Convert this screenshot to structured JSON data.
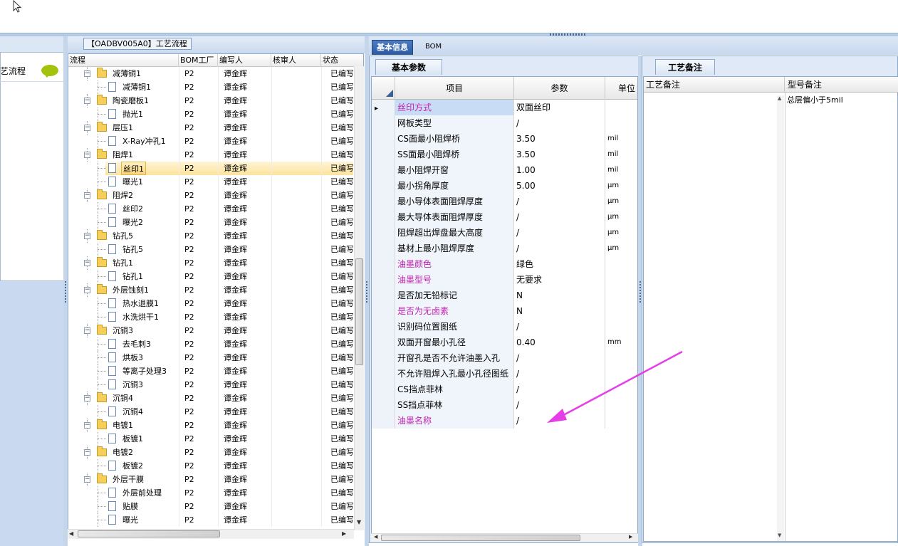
{
  "window": {
    "accent": "#2a5aa6",
    "note_color": "#c21fae"
  },
  "sidebar": {
    "label": "艺流程",
    "icon": "speech-bubble-icon"
  },
  "tree_panel": {
    "tab_title": "【OADBV005A0】工艺流程",
    "columns": [
      "流程",
      "BOM工厂",
      "编写人",
      "核审人",
      "状态"
    ],
    "rows": [
      {
        "name": "减薄铜1",
        "type": "folder",
        "bom": "P2",
        "author": "谭金辉",
        "reviewer": "",
        "status": "已编写"
      },
      {
        "name": "减薄铜1",
        "type": "item",
        "bom": "P2",
        "author": "谭金辉",
        "reviewer": "",
        "status": "已编写"
      },
      {
        "name": "陶瓷磨板1",
        "type": "folder",
        "bom": "P2",
        "author": "谭金辉",
        "reviewer": "",
        "status": "已编写"
      },
      {
        "name": "抛光1",
        "type": "item",
        "bom": "P2",
        "author": "谭金辉",
        "reviewer": "",
        "status": "已编写"
      },
      {
        "name": "层压1",
        "type": "folder",
        "bom": "P2",
        "author": "谭金辉",
        "reviewer": "",
        "status": "已编写"
      },
      {
        "name": "X-Ray冲孔1",
        "type": "item",
        "bom": "P2",
        "author": "谭金辉",
        "reviewer": "",
        "status": "已编写"
      },
      {
        "name": "阻焊1",
        "type": "folder",
        "bom": "P2",
        "author": "谭金辉",
        "reviewer": "",
        "status": "已编写"
      },
      {
        "name": "丝印1",
        "type": "item",
        "bom": "P2",
        "author": "谭金辉",
        "reviewer": "",
        "status": "已编写",
        "selected": true
      },
      {
        "name": "曝光1",
        "type": "item",
        "bom": "P2",
        "author": "谭金辉",
        "reviewer": "",
        "status": "已编写"
      },
      {
        "name": "阻焊2",
        "type": "folder",
        "bom": "P2",
        "author": "谭金辉",
        "reviewer": "",
        "status": "已编写"
      },
      {
        "name": "丝印2",
        "type": "item",
        "bom": "P2",
        "author": "谭金辉",
        "reviewer": "",
        "status": "已编写"
      },
      {
        "name": "曝光2",
        "type": "item",
        "bom": "P2",
        "author": "谭金辉",
        "reviewer": "",
        "status": "已编写"
      },
      {
        "name": "钻孔5",
        "type": "folder",
        "bom": "P2",
        "author": "谭金辉",
        "reviewer": "",
        "status": "已编写"
      },
      {
        "name": "钻孔5",
        "type": "item",
        "bom": "P2",
        "author": "谭金辉",
        "reviewer": "",
        "status": "已编写"
      },
      {
        "name": "钻孔1",
        "type": "folder",
        "bom": "P2",
        "author": "谭金辉",
        "reviewer": "",
        "status": "已编写"
      },
      {
        "name": "钻孔1",
        "type": "item",
        "bom": "P2",
        "author": "谭金辉",
        "reviewer": "",
        "status": "已编写"
      },
      {
        "name": "外层蚀刻1",
        "type": "folder",
        "bom": "P2",
        "author": "谭金辉",
        "reviewer": "",
        "status": "已编写"
      },
      {
        "name": "热水退膜1",
        "type": "item",
        "bom": "P2",
        "author": "谭金辉",
        "reviewer": "",
        "status": "已编写"
      },
      {
        "name": "水洗烘干1",
        "type": "item",
        "bom": "P2",
        "author": "谭金辉",
        "reviewer": "",
        "status": "已编写"
      },
      {
        "name": "沉铜3",
        "type": "folder",
        "bom": "P2",
        "author": "谭金辉",
        "reviewer": "",
        "status": "已编写"
      },
      {
        "name": "去毛刺3",
        "type": "item",
        "bom": "P2",
        "author": "谭金辉",
        "reviewer": "",
        "status": "已编写"
      },
      {
        "name": "烘板3",
        "type": "item",
        "bom": "P2",
        "author": "谭金辉",
        "reviewer": "",
        "status": "已编写"
      },
      {
        "name": "等离子处理3",
        "type": "item",
        "bom": "P2",
        "author": "谭金辉",
        "reviewer": "",
        "status": "已编写"
      },
      {
        "name": "沉铜3",
        "type": "item",
        "bom": "P2",
        "author": "谭金辉",
        "reviewer": "",
        "status": "已编写"
      },
      {
        "name": "沉铜4",
        "type": "folder",
        "bom": "P2",
        "author": "谭金辉",
        "reviewer": "",
        "status": "已编写"
      },
      {
        "name": "沉铜4",
        "type": "item",
        "bom": "P2",
        "author": "谭金辉",
        "reviewer": "",
        "status": "已编写"
      },
      {
        "name": "电镀1",
        "type": "folder",
        "bom": "P2",
        "author": "谭金辉",
        "reviewer": "",
        "status": "已编写"
      },
      {
        "name": "板镀1",
        "type": "item",
        "bom": "P2",
        "author": "谭金辉",
        "reviewer": "",
        "status": "已编写"
      },
      {
        "name": "电镀2",
        "type": "folder",
        "bom": "P2",
        "author": "谭金辉",
        "reviewer": "",
        "status": "已编写"
      },
      {
        "name": "板镀2",
        "type": "item",
        "bom": "P2",
        "author": "谭金辉",
        "reviewer": "",
        "status": "已编写"
      },
      {
        "name": "外层干膜",
        "type": "folder",
        "bom": "P2",
        "author": "谭金辉",
        "reviewer": "",
        "status": "已编写"
      },
      {
        "name": "外层前处理",
        "type": "item",
        "bom": "P2",
        "author": "谭金辉",
        "reviewer": "",
        "status": "已编写"
      },
      {
        "name": "贴膜",
        "type": "item",
        "bom": "P2",
        "author": "谭金辉",
        "reviewer": "",
        "status": "已编写"
      },
      {
        "name": "曝光",
        "type": "item",
        "bom": "P2",
        "author": "谭金辉",
        "reviewer": "",
        "status": "已编写"
      }
    ]
  },
  "main_tabs": [
    "基本信息",
    "BOM"
  ],
  "basic_params": {
    "tab": "基本参数",
    "columns": [
      "项目",
      "参数",
      "单位"
    ],
    "rows": [
      {
        "item": "丝印方式",
        "value": "双面丝印",
        "unit": "",
        "highlight": true,
        "current": true
      },
      {
        "item": "网板类型",
        "value": "/",
        "unit": ""
      },
      {
        "item": "CS面最小阻焊桥",
        "value": "3.50",
        "unit": "mil"
      },
      {
        "item": "SS面最小阻焊桥",
        "value": "3.50",
        "unit": "mil"
      },
      {
        "item": "最小阻焊开窗",
        "value": "1.00",
        "unit": "mil"
      },
      {
        "item": "最小拐角厚度",
        "value": "5.00",
        "unit": "μm"
      },
      {
        "item": "最小导体表面阻焊厚度",
        "value": "/",
        "unit": "μm"
      },
      {
        "item": "最大导体表面阻焊厚度",
        "value": "/",
        "unit": "μm"
      },
      {
        "item": "阻焊超出焊盘最大高度",
        "value": "/",
        "unit": "μm"
      },
      {
        "item": "基材上最小阻焊厚度",
        "value": "/",
        "unit": "μm"
      },
      {
        "item": "油墨颜色",
        "value": "绿色",
        "unit": "",
        "highlight": true
      },
      {
        "item": "油墨型号",
        "value": "无要求",
        "unit": "",
        "highlight": true
      },
      {
        "item": "是否加无铅标记",
        "value": "N",
        "unit": ""
      },
      {
        "item": "是否为无卤素",
        "value": "N",
        "unit": "",
        "highlight": true
      },
      {
        "item": "识别码位置图纸",
        "value": "/",
        "unit": ""
      },
      {
        "item": "双面开窗最小孔径",
        "value": "0.40",
        "unit": "mm"
      },
      {
        "item": "开窗孔是否不允许油墨入孔",
        "value": "/",
        "unit": ""
      },
      {
        "item": "不允许阻焊入孔最小孔径图纸",
        "value": "/",
        "unit": ""
      },
      {
        "item": "CS挡点菲林",
        "value": "/",
        "unit": ""
      },
      {
        "item": "SS挡点菲林",
        "value": "/",
        "unit": ""
      },
      {
        "item": "油墨名称",
        "value": "/",
        "unit": "",
        "highlight": true
      }
    ]
  },
  "process_notes": {
    "tab": "工艺备注",
    "columns": [
      "工艺备注",
      "型号备注"
    ],
    "model_note": "总层偏小于5mil"
  }
}
